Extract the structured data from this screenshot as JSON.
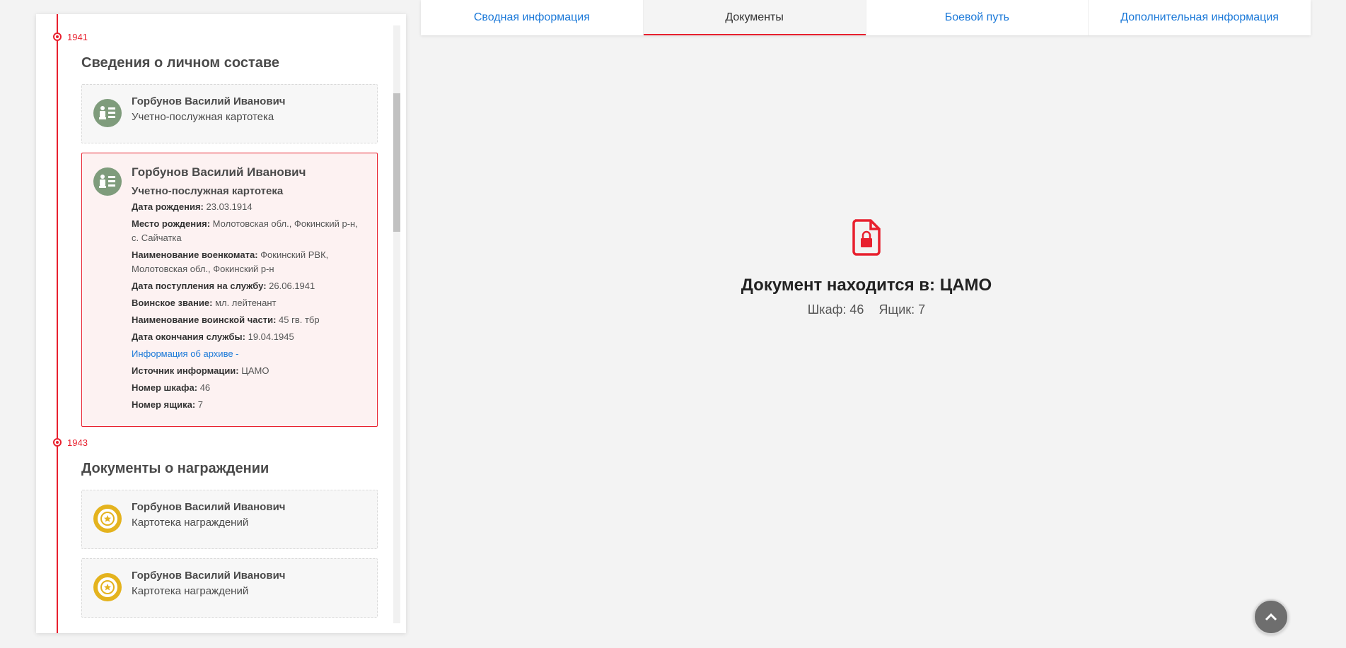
{
  "tabs": [
    {
      "label": "Сводная информация"
    },
    {
      "label": "Документы"
    },
    {
      "label": "Боевой путь"
    },
    {
      "label": "Дополнительная информация"
    }
  ],
  "timeline": {
    "group1": {
      "year": "1941",
      "title": "Сведения о личном составе",
      "card1": {
        "name": "Горбунов Василий Иванович",
        "type": "Учетно-послужная картотека"
      },
      "card2": {
        "name": "Горбунов Василий Иванович",
        "type": "Учетно-послужная картотека",
        "fields": [
          {
            "label": "Дата рождения:",
            "value": "23.03.1914"
          },
          {
            "label": "Место рождения:",
            "value": "Молотовская обл., Фокинский р-н, с. Сайчатка"
          },
          {
            "label": "Наименование военкомата:",
            "value": "Фокинский РВК, Молотовская обл., Фокинский р-н"
          },
          {
            "label": "Дата поступления на службу:",
            "value": "26.06.1941"
          },
          {
            "label": "Воинское звание:",
            "value": "мл. лейтенант"
          },
          {
            "label": "Наименование воинской части:",
            "value": "45 гв. тбр"
          },
          {
            "label": "Дата окончания службы:",
            "value": "19.04.1945"
          }
        ],
        "archive_link": "Информация об архиве -",
        "fields2": [
          {
            "label": "Источник информации:",
            "value": "ЦАМО"
          },
          {
            "label": "Номер шкафа:",
            "value": "46"
          },
          {
            "label": "Номер ящика:",
            "value": "7"
          }
        ]
      }
    },
    "group2": {
      "year": "1943",
      "title": "Документы о награждении",
      "card1": {
        "name": "Горбунов Василий Иванович",
        "type": "Картотека награждений"
      },
      "card2": {
        "name": "Горбунов Василий Иванович",
        "type": "Картотека награждений"
      }
    }
  },
  "document": {
    "icon": "locked-document-icon",
    "title": "Документ находится в: ЦАМО",
    "cabinet": "Шкаф: 46",
    "box": "Ящик: 7"
  },
  "colors": {
    "accent": "#e8202e",
    "link": "#1a78d8",
    "person_icon": "#7f9c7c",
    "award_icon": "#e4b31e"
  }
}
